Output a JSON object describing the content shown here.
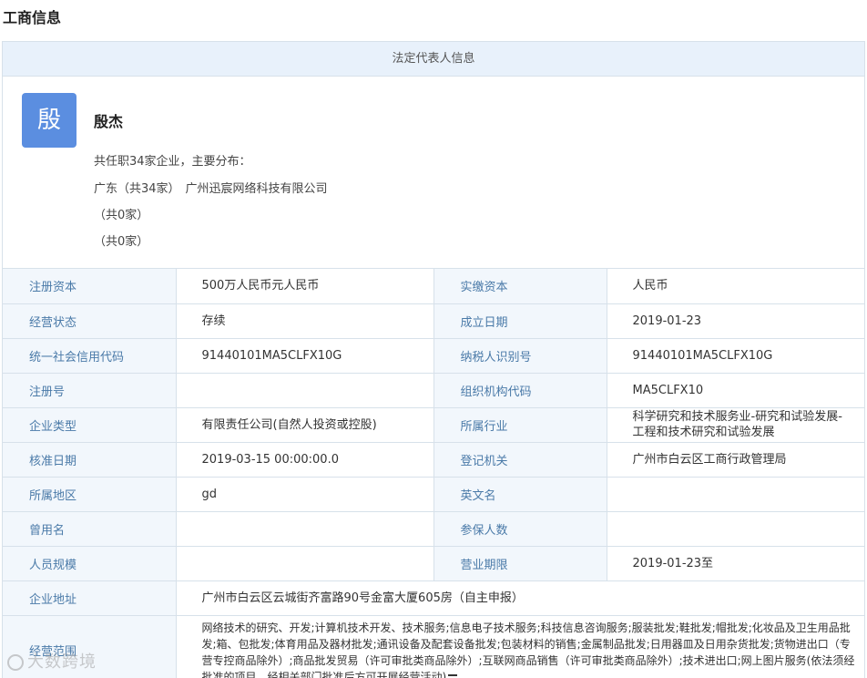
{
  "page": {
    "title": "工商信息"
  },
  "legal_rep_section": {
    "header": "法定代表人信息",
    "avatar_char": "殷",
    "name": "殷杰",
    "summary": "共任职34家企业，主要分布：",
    "distributions": [
      {
        "region": "广东（共34家）",
        "company": "广州迅宸网络科技有限公司"
      },
      {
        "region": "（共0家）",
        "company": ""
      },
      {
        "region": "（共0家）",
        "company": ""
      }
    ]
  },
  "info_rows": [
    {
      "label1": "注册资本",
      "value1": "500万人民币元人民币",
      "label2": "实缴资本",
      "value2": "人民币"
    },
    {
      "label1": "经营状态",
      "value1": "存续",
      "label2": "成立日期",
      "value2": "2019-01-23"
    },
    {
      "label1": "统一社会信用代码",
      "value1": "91440101MA5CLFX10G",
      "label2": "纳税人识别号",
      "value2": "91440101MA5CLFX10G"
    },
    {
      "label1": "注册号",
      "value1": "",
      "label2": "组织机构代码",
      "value2": "MA5CLFX10"
    },
    {
      "label1": "企业类型",
      "value1": "有限责任公司(自然人投资或控股)",
      "label2": "所属行业",
      "value2": "科学研究和技术服务业-研究和试验发展- 工程和技术研究和试验发展"
    },
    {
      "label1": "核准日期",
      "value1": "2019-03-15 00:00:00.0",
      "label2": "登记机关",
      "value2": "广州市白云区工商行政管理局"
    },
    {
      "label1": "所属地区",
      "value1": "gd",
      "label2": "英文名",
      "value2": ""
    },
    {
      "label1": "曾用名",
      "value1": "",
      "label2": "参保人数",
      "value2": ""
    },
    {
      "label1": "人员规模",
      "value1": "",
      "label2": "营业期限",
      "value2": "2019-01-23至"
    }
  ],
  "address": {
    "label": "企业地址",
    "value": "广州市白云区云城街齐富路90号金富大厦605房（自主申报）"
  },
  "scope": {
    "label": "经营范围",
    "value": "网络技术的研究、开发;计算机技术开发、技术服务;信息电子技术服务;科技信息咨询服务;服装批发;鞋批发;帽批发;化妆品及卫生用品批发;箱、包批发;体育用品及器材批发;通讯设备及配套设备批发;包装材料的销售;金属制品批发;日用器皿及日用杂货批发;货物进出口（专营专控商品除外）;商品批发贸易（许可审批类商品除外）;互联网商品销售（许可审批类商品除外）;技术进出口;网上图片服务(依法须经批准的项目，经相关部门批准后方可开展经营活动)"
  },
  "watermark": {
    "text": "大数跨境"
  },
  "colors": {
    "header_bg": "#e8f1fb",
    "label_bg": "#f2f7fc",
    "label_text": "#4a7aa8",
    "avatar_bg": "#5b8ee0",
    "border": "#d7e1ea"
  }
}
